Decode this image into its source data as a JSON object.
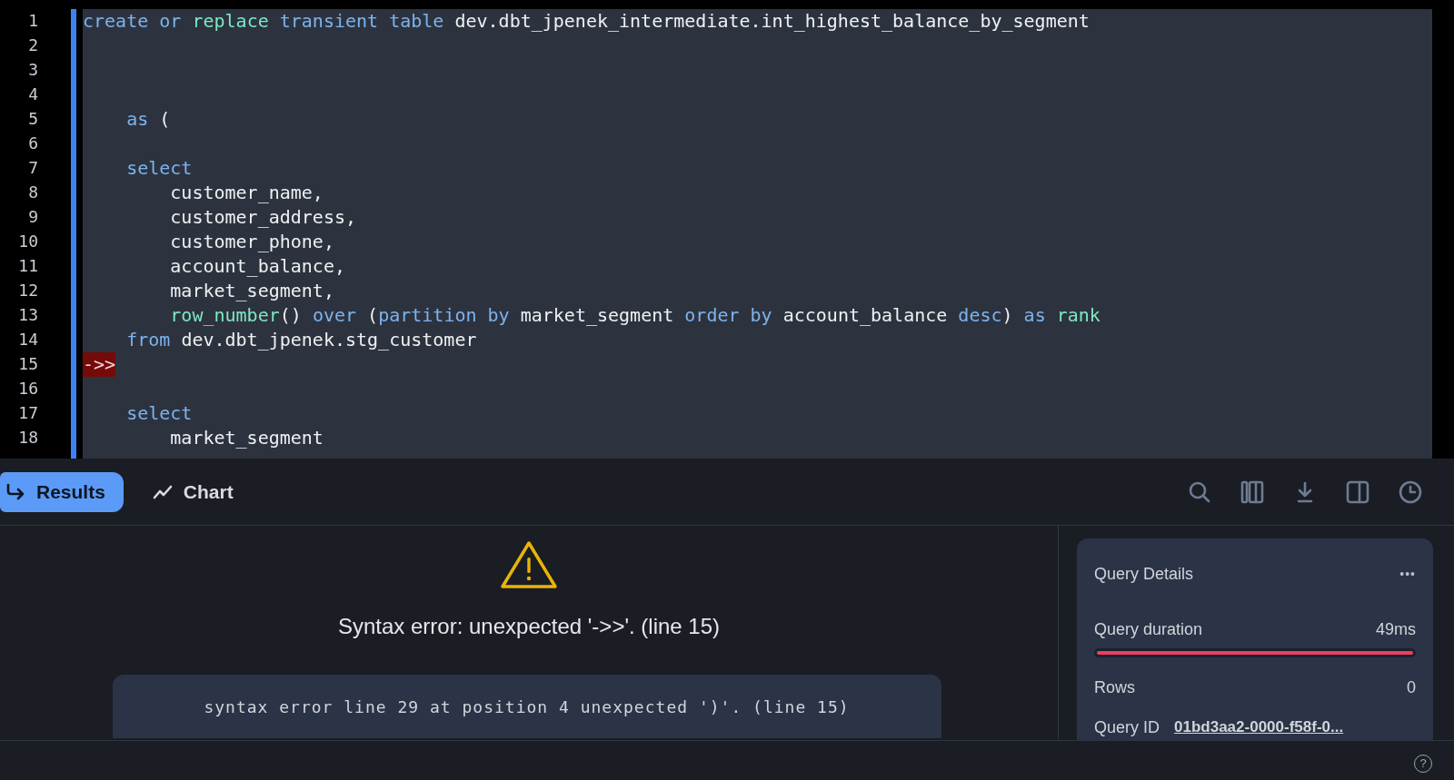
{
  "editor": {
    "lines": [
      {
        "number": "1",
        "tokens": [
          {
            "text": "create ",
            "kind": "keyword"
          },
          {
            "text": "or ",
            "kind": "keyword"
          },
          {
            "text": "replace ",
            "kind": "function"
          },
          {
            "text": "transient ",
            "kind": "keyword"
          },
          {
            "text": "table ",
            "kind": "keyword"
          },
          {
            "text": "dev.dbt_jpenek_intermediate.int_highest_balance_by_segment",
            "kind": "plain"
          }
        ]
      },
      {
        "number": "2"
      },
      {
        "number": "3"
      },
      {
        "number": "4"
      },
      {
        "number": "5",
        "tokens": [
          {
            "text": "    as ",
            "kind": "keyword"
          },
          {
            "text": "(",
            "kind": "plain"
          }
        ]
      },
      {
        "number": "6"
      },
      {
        "number": "7",
        "tokens": [
          {
            "text": "    select",
            "kind": "keyword"
          }
        ]
      },
      {
        "number": "8",
        "tokens": [
          {
            "text": "        customer_name,",
            "kind": "plain"
          }
        ]
      },
      {
        "number": "9",
        "tokens": [
          {
            "text": "        customer_address,",
            "kind": "plain"
          }
        ]
      },
      {
        "number": "10",
        "tokens": [
          {
            "text": "        customer_phone,",
            "kind": "plain"
          }
        ]
      },
      {
        "number": "11",
        "tokens": [
          {
            "text": "        account_balance,",
            "kind": "plain"
          }
        ]
      },
      {
        "number": "12",
        "tokens": [
          {
            "text": "        market_segment,",
            "kind": "plain"
          }
        ]
      },
      {
        "number": "13",
        "tokens": [
          {
            "text": "        row_number",
            "kind": "function"
          },
          {
            "text": "() ",
            "kind": "plain"
          },
          {
            "text": "over ",
            "kind": "keyword"
          },
          {
            "text": "(",
            "kind": "plain"
          },
          {
            "text": "partition ",
            "kind": "keyword"
          },
          {
            "text": "by ",
            "kind": "keyword"
          },
          {
            "text": "market_segment ",
            "kind": "plain"
          },
          {
            "text": "order ",
            "kind": "keyword"
          },
          {
            "text": "by ",
            "kind": "keyword"
          },
          {
            "text": "account_balance ",
            "kind": "plain"
          },
          {
            "text": "desc",
            "kind": "keyword"
          },
          {
            "text": ") ",
            "kind": "plain"
          },
          {
            "text": "as ",
            "kind": "keyword"
          },
          {
            "text": "rank",
            "kind": "function"
          }
        ]
      },
      {
        "number": "14",
        "tokens": [
          {
            "text": "    from ",
            "kind": "keyword"
          },
          {
            "text": "dev.dbt_jpenek.stg_customer",
            "kind": "plain"
          }
        ]
      },
      {
        "number": "15",
        "tokens": [
          {
            "text": "->>",
            "kind": "error"
          }
        ]
      },
      {
        "number": "16"
      },
      {
        "number": "17",
        "tokens": [
          {
            "text": "    select",
            "kind": "keyword"
          }
        ]
      },
      {
        "number": "18",
        "tokens": [
          {
            "text": "        market_segment",
            "kind": "plain"
          }
        ]
      }
    ]
  },
  "tabs": [
    {
      "label": "Results",
      "selected": true,
      "kind": "results"
    },
    {
      "label": "Chart",
      "selected": false,
      "kind": "chart"
    }
  ],
  "toolbar": [
    {
      "kind": "search"
    },
    {
      "kind": "columns"
    },
    {
      "kind": "download"
    },
    {
      "kind": "panel"
    },
    {
      "kind": "history"
    }
  ],
  "error": {
    "message": "Syntax error: unexpected '->>'. (line 15)",
    "detail": "syntax error line 29 at position 4 unexpected ')'. (line 15)"
  },
  "query_details": {
    "title": "Query Details",
    "menu": "•••",
    "duration_label": "Query duration",
    "duration": "49ms",
    "level": 1,
    "rows_label": "Rows",
    "rows": "0",
    "id_label": "Query ID",
    "id": "01bd3aa2-0000-f58f-0..."
  },
  "footer": {
    "help": "?"
  }
}
